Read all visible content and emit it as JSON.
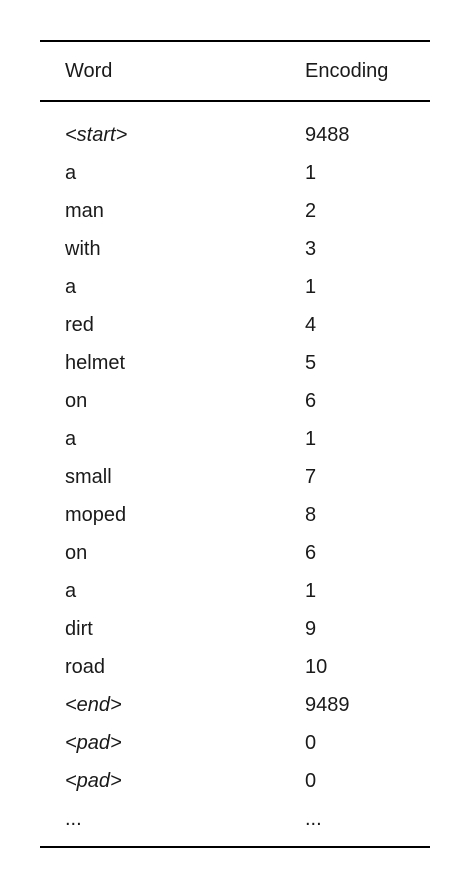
{
  "table": {
    "headers": {
      "word": "Word",
      "encoding": "Encoding"
    },
    "rows": [
      {
        "word": "<start>",
        "encoding": "9488",
        "special": true
      },
      {
        "word": "a",
        "encoding": "1",
        "special": false
      },
      {
        "word": "man",
        "encoding": "2",
        "special": false
      },
      {
        "word": "with",
        "encoding": "3",
        "special": false
      },
      {
        "word": "a",
        "encoding": "1",
        "special": false
      },
      {
        "word": "red",
        "encoding": "4",
        "special": false
      },
      {
        "word": "helmet",
        "encoding": "5",
        "special": false
      },
      {
        "word": "on",
        "encoding": "6",
        "special": false
      },
      {
        "word": "a",
        "encoding": "1",
        "special": false
      },
      {
        "word": "small",
        "encoding": "7",
        "special": false
      },
      {
        "word": "moped",
        "encoding": "8",
        "special": false
      },
      {
        "word": "on",
        "encoding": "6",
        "special": false
      },
      {
        "word": "a",
        "encoding": "1",
        "special": false
      },
      {
        "word": "dirt",
        "encoding": "9",
        "special": false
      },
      {
        "word": "road",
        "encoding": "10",
        "special": false
      },
      {
        "word": "<end>",
        "encoding": "9489",
        "special": true
      },
      {
        "word": "<pad>",
        "encoding": "0",
        "special": true
      },
      {
        "word": "<pad>",
        "encoding": "0",
        "special": true
      },
      {
        "word": "...",
        "encoding": "...",
        "special": false
      }
    ]
  }
}
